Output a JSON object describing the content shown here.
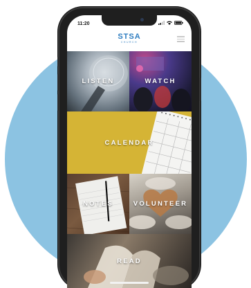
{
  "status_bar": {
    "time": "11:20",
    "signal_icon": "signal-icon",
    "wifi_icon": "wifi-icon",
    "battery_icon": "battery-icon"
  },
  "header": {
    "logo_text": "STSA",
    "logo_subtext": "CHURCH",
    "menu_icon": "hamburger-menu-icon"
  },
  "tiles": {
    "listen": "LISTEN",
    "watch": "WATCH",
    "calendar": "CALENDAR",
    "notes": "NOTES",
    "volunteer": "VOLUNTEER",
    "read": "READ"
  },
  "colors": {
    "background_circle": "#8cc3e2",
    "brand_blue": "#2e7dc0",
    "calendar_yellow": "#d5b435"
  }
}
